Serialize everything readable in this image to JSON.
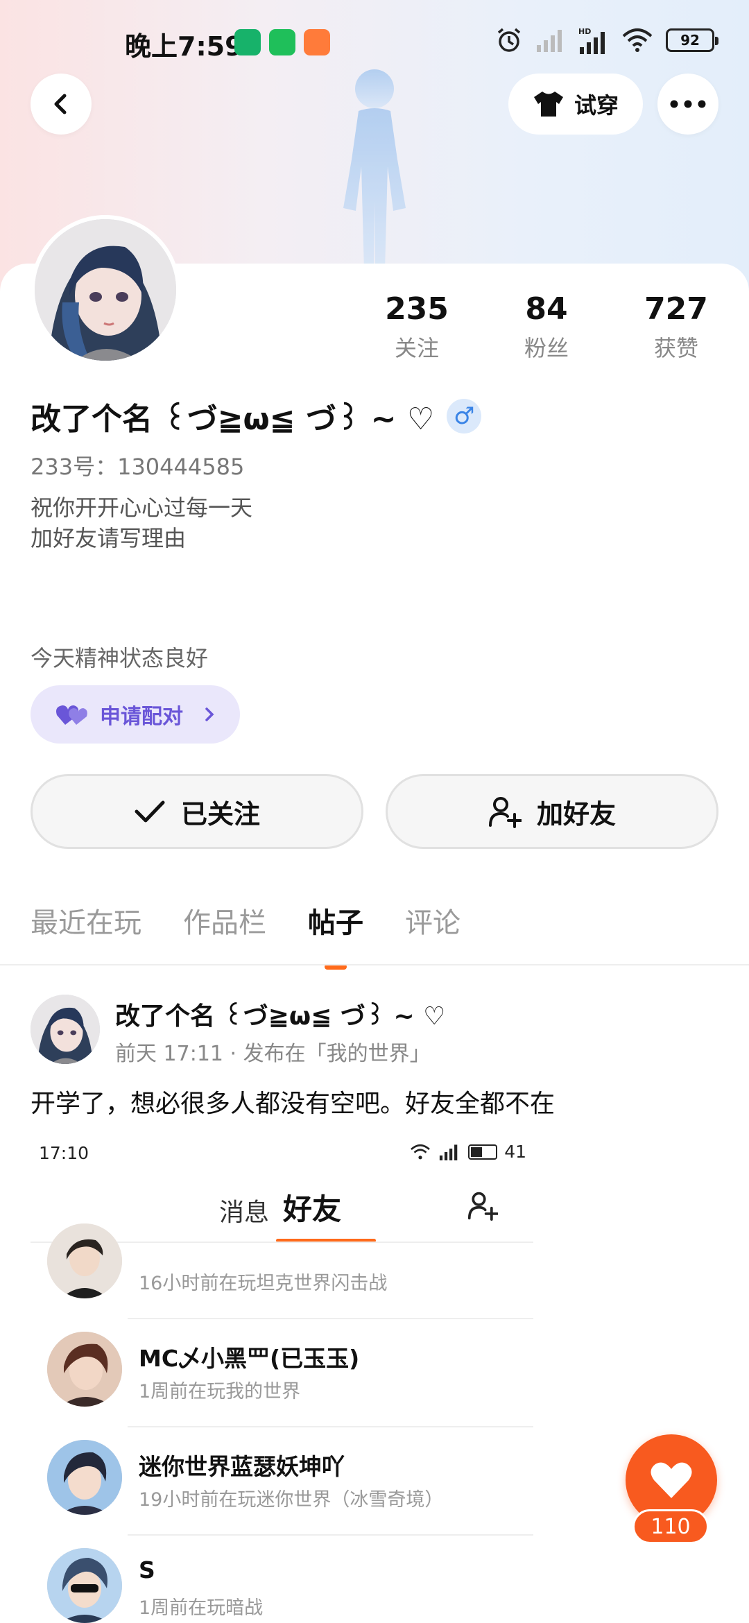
{
  "status_bar": {
    "time": "晚上7:59",
    "battery": "92"
  },
  "header": {
    "try_on_label": "试穿"
  },
  "profile": {
    "stats": [
      {
        "value": "235",
        "label": "关注"
      },
      {
        "value": "84",
        "label": "粉丝"
      },
      {
        "value": "727",
        "label": "获赞"
      }
    ],
    "username": "改了个名 ꒰づ≧ω≦ づ꒱ ~ ♡",
    "id_text": "233号：130444585",
    "bio_line1": "祝你开开心心过每一天",
    "bio_line2": "加好友请写理由",
    "mood": "今天精神状态良好",
    "pair_label": "申请配对",
    "followed_label": "已关注",
    "add_friend_label": "加好友"
  },
  "tabs": [
    {
      "label": "最近在玩",
      "active": false
    },
    {
      "label": "作品栏",
      "active": false
    },
    {
      "label": "帖子",
      "active": true
    },
    {
      "label": "评论",
      "active": false
    }
  ],
  "post": {
    "author": "改了个名 ꒰づ≧ω≦ づ꒱ ~ ♡",
    "meta": "前天 17:11 · 发布在「我的世界」",
    "text": "开学了，想必很多人都没有空吧。好友全都不在",
    "screenshot": {
      "time": "17:10",
      "battery": "41",
      "tab_messages": "消息",
      "tab_friends": "好友",
      "friends": [
        {
          "name": "",
          "status": "16小时前在玩坦克世界闪击战"
        },
        {
          "name": "MC乄小黑罒(已玉玉)",
          "status": "1周前在玩我的世界"
        },
        {
          "name": "迷你世界蓝瑟妖坤吖",
          "status": "19小时前在玩迷你世界（冰雪奇境）"
        },
        {
          "name": "S",
          "status": "1周前在玩暗战"
        }
      ]
    }
  },
  "like": {
    "count": "110"
  },
  "colors": {
    "accent": "#ff6a1a",
    "like": "#f85a1f",
    "pair_text": "#6a56d8",
    "pair_bg": "#eae7fb"
  }
}
